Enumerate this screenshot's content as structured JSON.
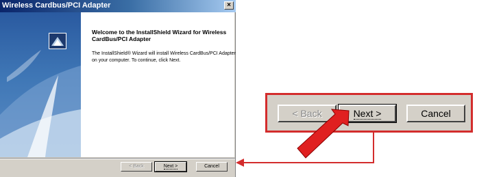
{
  "window": {
    "title": "Wireless Cardbus/PCI Adapter",
    "close_symbol": "×"
  },
  "wizard": {
    "heading": "Welcome to the InstallShield Wizard for Wireless CardBus/PCI Adapter",
    "body": "The InstallShield® Wizard will install Wireless CardBus/PCI Adapter on your computer.  To continue, click Next."
  },
  "buttons": {
    "back_label": "< Back",
    "next_label": "Next >",
    "cancel_label": "Cancel"
  },
  "zoom": {
    "back_label": "< Back",
    "next_label": "Next >",
    "cancel_label": "Cancel"
  },
  "colors": {
    "highlight_red": "#d32c2c",
    "dialog_gray": "#d4d0c8",
    "title_blue": "#0a246a"
  },
  "icons": {
    "close": "close-icon",
    "app": "installshield-icon",
    "pointer_arrow": "red-pointer-arrow-icon"
  }
}
